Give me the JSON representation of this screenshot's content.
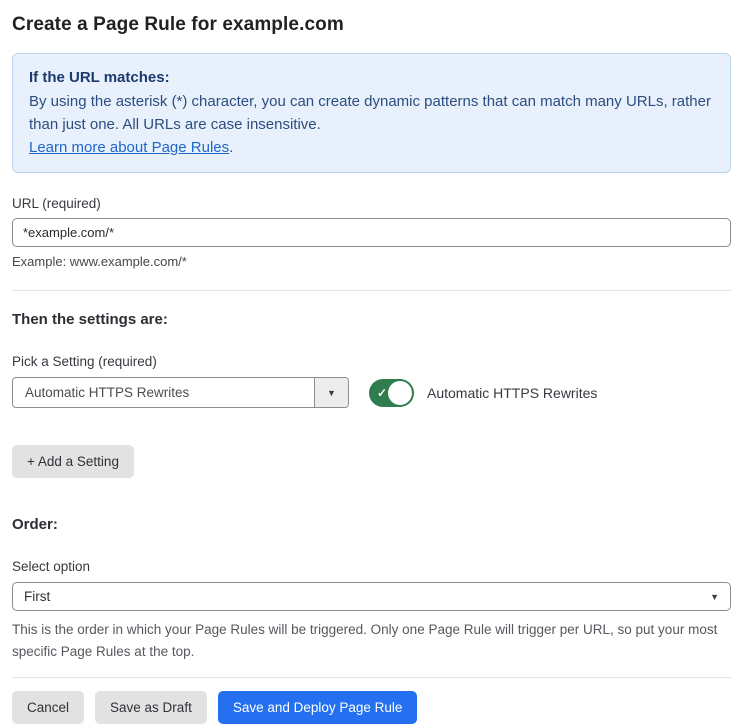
{
  "page": {
    "title": "Create a Page Rule for example.com"
  },
  "callout": {
    "heading": "If the URL matches:",
    "body": "By using the asterisk (*) character, you can create dynamic patterns that can match many URLs, rather than just one. All URLs are case insensitive.",
    "link_label": "Learn more about Page Rules",
    "link_suffix": "."
  },
  "url_field": {
    "label": "URL (required)",
    "value": "*example.com/*",
    "hint": "Example: www.example.com/*"
  },
  "settings": {
    "heading": "Then the settings are:",
    "picker_label": "Pick a Setting (required)",
    "selected_setting": "Automatic HTTPS Rewrites",
    "toggle_label": "Automatic HTTPS Rewrites",
    "toggle_state": "on",
    "add_setting_label": "+ Add a Setting"
  },
  "order": {
    "heading": "Order:",
    "select_label": "Select option",
    "selected_option": "First",
    "help_text": "This is the order in which your Page Rules will be triggered. Only one Page Rule will trigger per URL, so put your most specific Page Rules at the top."
  },
  "footer": {
    "cancel_label": "Cancel",
    "save_draft_label": "Save as Draft",
    "deploy_label": "Save and Deploy Page Rule"
  },
  "icons": {
    "caret_down": "▼",
    "check": "✓"
  },
  "colors": {
    "accent_blue": "#2470f1",
    "toggle_green": "#2f7d4f",
    "callout_bg": "#e8f1fb",
    "callout_border": "#bdd6f0",
    "callout_text": "#2c4d80",
    "link_blue": "#2166cb"
  }
}
